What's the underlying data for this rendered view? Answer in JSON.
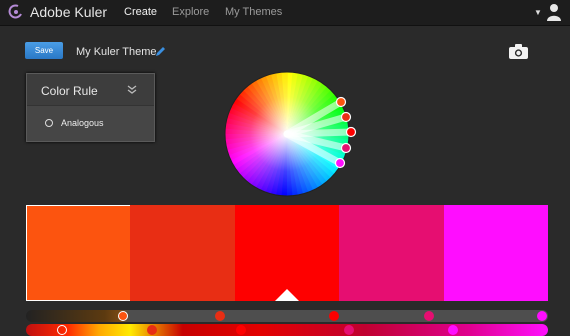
{
  "header": {
    "app_title": "Adobe Kuler",
    "nav": [
      {
        "label": "Create",
        "active": true
      },
      {
        "label": "Explore",
        "active": false
      },
      {
        "label": "My Themes",
        "active": false
      }
    ],
    "user_icon": "user-icon"
  },
  "toolbar": {
    "save_label": "Save",
    "theme_name": "My Kuler Theme",
    "edit_icon": "pencil-icon",
    "camera_icon": "camera-icon"
  },
  "color_rule": {
    "title": "Color Rule",
    "selected_option": "Analogous"
  },
  "swatches": [
    {
      "color": "#fc540f",
      "selected": true
    },
    {
      "color": "#e82e14",
      "selected": false
    },
    {
      "color": "#fe0000",
      "selected": false
    },
    {
      "color": "#e60e71",
      "selected": false
    },
    {
      "color": "#ff0dff",
      "selected": false
    }
  ],
  "colors": {
    "background": "#2a2a2a",
    "topbar": "#1d1d1d",
    "accent": "#2a78c6"
  }
}
